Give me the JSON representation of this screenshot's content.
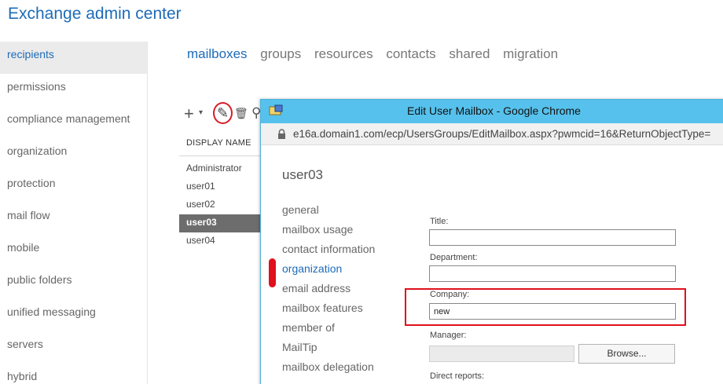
{
  "app_title": "Exchange admin center",
  "left_nav": [
    {
      "label": "recipients",
      "active": true
    },
    {
      "label": "permissions"
    },
    {
      "label": "compliance management"
    },
    {
      "label": "organization"
    },
    {
      "label": "protection"
    },
    {
      "label": "mail flow"
    },
    {
      "label": "mobile"
    },
    {
      "label": "public folders"
    },
    {
      "label": "unified messaging"
    },
    {
      "label": "servers"
    },
    {
      "label": "hybrid"
    }
  ],
  "sub_tabs": [
    {
      "label": "mailboxes",
      "active": true
    },
    {
      "label": "groups"
    },
    {
      "label": "resources"
    },
    {
      "label": "contacts"
    },
    {
      "label": "shared"
    },
    {
      "label": "migration"
    }
  ],
  "toolbar": {
    "add_glyph": "+",
    "dropdown_glyph": "▾",
    "edit_glyph": "✎",
    "delete_glyph": "🗑",
    "search_glyph": "⚲"
  },
  "list": {
    "header": "DISPLAY NAME",
    "rows": [
      "Administrator",
      "user01",
      "user02",
      "user03",
      "user04"
    ],
    "selected": "user03"
  },
  "dialog": {
    "window_title": "Edit User Mailbox - Google Chrome",
    "url": "e16a.domain1.com/ecp/UsersGroups/EditMailbox.aspx?pwmcid=16&ReturnObjectType=",
    "user_title": "user03",
    "nav": [
      "general",
      "mailbox usage",
      "contact information",
      "organization",
      "email address",
      "mailbox features",
      "member of",
      "MailTip",
      "mailbox delegation"
    ],
    "active_nav": "organization",
    "fields": {
      "title_label": "Title:",
      "title_value": "",
      "department_label": "Department:",
      "department_value": "",
      "company_label": "Company:",
      "company_value": "new",
      "manager_label": "Manager:",
      "manager_value": "",
      "browse_label": "Browse...",
      "direct_reports_label": "Direct reports:"
    }
  },
  "colors": {
    "accent": "#1e6bb8",
    "titlebar": "#56c1ec",
    "highlight": "#e0111d"
  }
}
